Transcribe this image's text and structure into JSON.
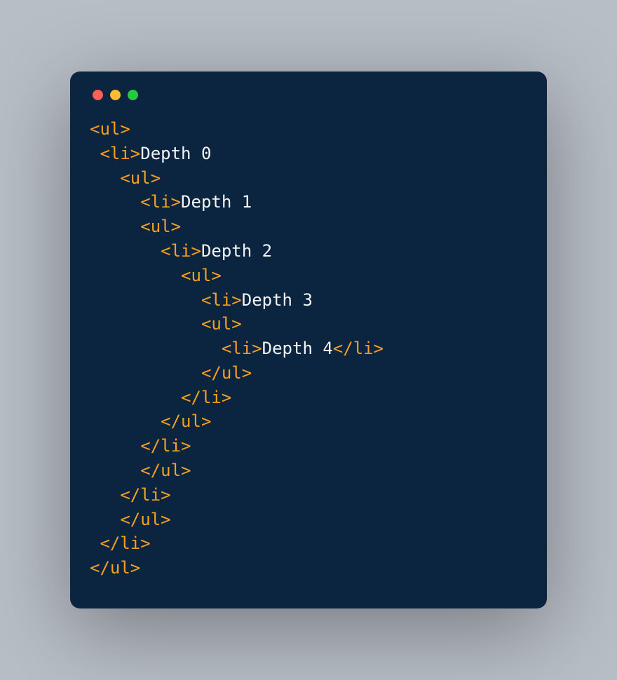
{
  "colors": {
    "page_bg": "#b8bec6",
    "window_bg": "#0b2540",
    "tag": "#f6a01f",
    "text": "#f3f4f5",
    "dot_red": "#ff5f56",
    "dot_yellow": "#ffbd2e",
    "dot_green": "#27c93f"
  },
  "traffic_lights": [
    "close",
    "minimize",
    "zoom"
  ],
  "code_lines": [
    {
      "indent": 0,
      "segments": [
        {
          "kind": "tag",
          "text": "<ul>"
        }
      ]
    },
    {
      "indent": 1,
      "segments": [
        {
          "kind": "tag",
          "text": "<li>"
        },
        {
          "kind": "txt",
          "text": "Depth 0"
        }
      ]
    },
    {
      "indent": 3,
      "segments": [
        {
          "kind": "tag",
          "text": "<ul>"
        }
      ]
    },
    {
      "indent": 5,
      "segments": [
        {
          "kind": "tag",
          "text": "<li>"
        },
        {
          "kind": "txt",
          "text": "Depth 1"
        }
      ]
    },
    {
      "indent": 5,
      "segments": [
        {
          "kind": "tag",
          "text": "<ul>"
        }
      ]
    },
    {
      "indent": 7,
      "segments": [
        {
          "kind": "tag",
          "text": "<li>"
        },
        {
          "kind": "txt",
          "text": "Depth 2"
        }
      ]
    },
    {
      "indent": 9,
      "segments": [
        {
          "kind": "tag",
          "text": "<ul>"
        }
      ]
    },
    {
      "indent": 11,
      "segments": [
        {
          "kind": "tag",
          "text": "<li>"
        },
        {
          "kind": "txt",
          "text": "Depth 3"
        }
      ]
    },
    {
      "indent": 11,
      "segments": [
        {
          "kind": "tag",
          "text": "<ul>"
        }
      ]
    },
    {
      "indent": 13,
      "segments": [
        {
          "kind": "tag",
          "text": "<li>"
        },
        {
          "kind": "txt",
          "text": "Depth 4"
        },
        {
          "kind": "tag",
          "text": "</li>"
        }
      ]
    },
    {
      "indent": 11,
      "segments": [
        {
          "kind": "tag",
          "text": "</ul>"
        }
      ]
    },
    {
      "indent": 9,
      "segments": [
        {
          "kind": "tag",
          "text": "</li>"
        }
      ]
    },
    {
      "indent": 7,
      "segments": [
        {
          "kind": "tag",
          "text": "</ul>"
        }
      ]
    },
    {
      "indent": 5,
      "segments": [
        {
          "kind": "tag",
          "text": "</li>"
        }
      ]
    },
    {
      "indent": 5,
      "segments": [
        {
          "kind": "tag",
          "text": "</ul>"
        }
      ]
    },
    {
      "indent": 3,
      "segments": [
        {
          "kind": "tag",
          "text": "</li>"
        }
      ]
    },
    {
      "indent": 3,
      "segments": [
        {
          "kind": "tag",
          "text": "</ul>"
        }
      ]
    },
    {
      "indent": 1,
      "segments": [
        {
          "kind": "tag",
          "text": "</li>"
        }
      ]
    },
    {
      "indent": 0,
      "segments": [
        {
          "kind": "tag",
          "text": "</ul>"
        }
      ]
    }
  ]
}
